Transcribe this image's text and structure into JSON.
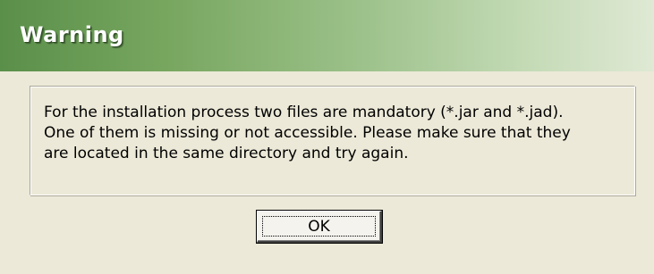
{
  "dialog": {
    "title": "Warning",
    "message_lines": [
      "For the installation process two files are mandatory (*.jar and *.jad).",
      "One of them is missing or not accessible. Please make sure that they",
      "are located in the same directory and try again."
    ],
    "ok_label": "OK"
  },
  "colors": {
    "title_gradient_start": "#5a8f4a",
    "title_gradient_end": "#dfe9d4",
    "dialog_background": "#ece9d8",
    "title_text": "#ffffff"
  }
}
